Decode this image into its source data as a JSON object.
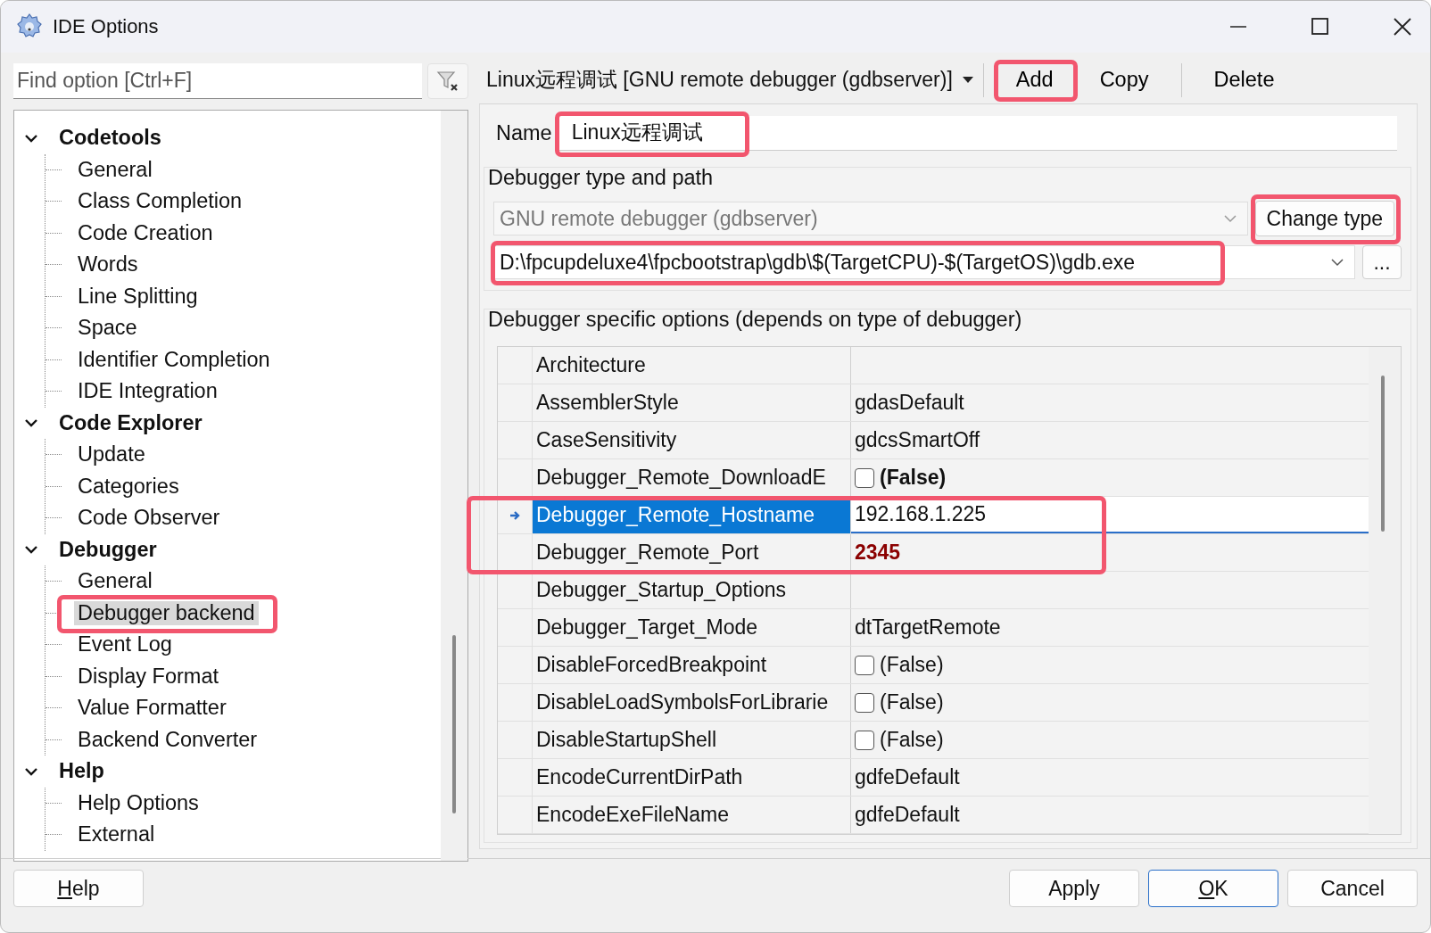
{
  "window": {
    "title": "IDE Options"
  },
  "search": {
    "placeholder": "Find option [Ctrl+F]"
  },
  "tree": [
    {
      "label": "Codetools",
      "expanded": true,
      "selected": false,
      "children": [
        {
          "label": "General",
          "selected": false
        },
        {
          "label": "Class Completion",
          "selected": false
        },
        {
          "label": "Code Creation",
          "selected": false
        },
        {
          "label": "Words",
          "selected": false
        },
        {
          "label": "Line Splitting",
          "selected": false
        },
        {
          "label": "Space",
          "selected": false
        },
        {
          "label": "Identifier Completion",
          "selected": false
        },
        {
          "label": "IDE Integration",
          "selected": false
        }
      ]
    },
    {
      "label": "Code Explorer",
      "expanded": true,
      "selected": false,
      "children": [
        {
          "label": "Update",
          "selected": false
        },
        {
          "label": "Categories",
          "selected": false
        },
        {
          "label": "Code Observer",
          "selected": false
        }
      ]
    },
    {
      "label": "Debugger",
      "expanded": true,
      "selected": false,
      "children": [
        {
          "label": "General",
          "selected": false
        },
        {
          "label": "Debugger backend",
          "selected": true,
          "highlighted": true
        },
        {
          "label": "Event Log",
          "selected": false
        },
        {
          "label": "Display Format",
          "selected": false
        },
        {
          "label": "Value Formatter",
          "selected": false
        },
        {
          "label": "Backend Converter",
          "selected": false
        }
      ]
    },
    {
      "label": "Help",
      "expanded": true,
      "selected": false,
      "children": [
        {
          "label": "Help Options",
          "selected": false
        },
        {
          "label": "External",
          "selected": false
        }
      ]
    }
  ],
  "debugger_bar": {
    "profile": "Linux远程调试 [GNU remote debugger (gdbserver)]",
    "buttons": [
      {
        "label": "Add",
        "highlighted": true
      },
      {
        "label": "Copy",
        "highlighted": false
      },
      {
        "label": "Delete",
        "highlighted": false
      }
    ]
  },
  "name": {
    "label": "Name",
    "value": "Linux远程调试",
    "highlighted": true
  },
  "type_group": {
    "title": "Debugger type and path",
    "type": {
      "value": "GNU remote debugger (gdbserver)",
      "disabled": true
    },
    "change_type": {
      "label": "Change type",
      "highlighted": true
    },
    "path": {
      "value": "D:\\fpcupdeluxe4\\fpcbootstrap\\gdb\\$(TargetCPU)-$(TargetOS)\\gdb.exe",
      "highlighted": true
    },
    "browse": {
      "label": "..."
    }
  },
  "options_group": {
    "title": "Debugger specific options (depends on type of debugger)",
    "rows": [
      {
        "name": "Architecture",
        "kind": "text",
        "selected": false,
        "highlighted": false
      },
      {
        "name": "AssemblerStyle",
        "kind": "text",
        "value": "gdasDefault",
        "selected": false,
        "highlighted": false
      },
      {
        "name": "CaseSensitivity",
        "kind": "text",
        "value": "gdcsSmartOff",
        "selected": false,
        "highlighted": false
      },
      {
        "name": "Debugger_Remote_DownloadE",
        "kind": "checkbox",
        "checked": false,
        "value": "(False)",
        "modified": true,
        "edited": false,
        "selected": false,
        "highlighted": false
      },
      {
        "name": "Debugger_Remote_Hostname",
        "kind": "edit",
        "value": "192.168.1.225",
        "selected": true,
        "highlighted": true
      },
      {
        "name": "Debugger_Remote_Port",
        "kind": "text",
        "value": "2345",
        "modified": true,
        "edited": true,
        "selected": false,
        "highlighted": true
      },
      {
        "name": "Debugger_Startup_Options",
        "kind": "text",
        "selected": false,
        "highlighted": false
      },
      {
        "name": "Debugger_Target_Mode",
        "kind": "text",
        "value": "dtTargetRemote",
        "selected": false,
        "highlighted": false
      },
      {
        "name": "DisableForcedBreakpoint",
        "kind": "checkbox",
        "checked": false,
        "value": "(False)",
        "selected": false,
        "highlighted": false
      },
      {
        "name": "DisableLoadSymbolsForLibrarie",
        "kind": "checkbox",
        "checked": false,
        "value": "(False)",
        "selected": false,
        "highlighted": false
      },
      {
        "name": "DisableStartupShell",
        "kind": "checkbox",
        "checked": false,
        "value": "(False)",
        "selected": false,
        "highlighted": false
      },
      {
        "name": "EncodeCurrentDirPath",
        "kind": "text",
        "value": "gdfeDefault",
        "selected": false,
        "highlighted": false
      },
      {
        "name": "EncodeExeFileName",
        "kind": "text",
        "value": "gdfeDefault",
        "selected": false,
        "highlighted": false
      }
    ]
  },
  "footer": {
    "left_buttons": [
      {
        "label": "Help",
        "accelerator": true,
        "default": false
      }
    ],
    "right_buttons": [
      {
        "label": "Apply",
        "accelerator": false,
        "default": false
      },
      {
        "label": "OK",
        "accelerator": true,
        "default": true
      },
      {
        "label": "Cancel",
        "accelerator": false,
        "default": false
      }
    ]
  }
}
